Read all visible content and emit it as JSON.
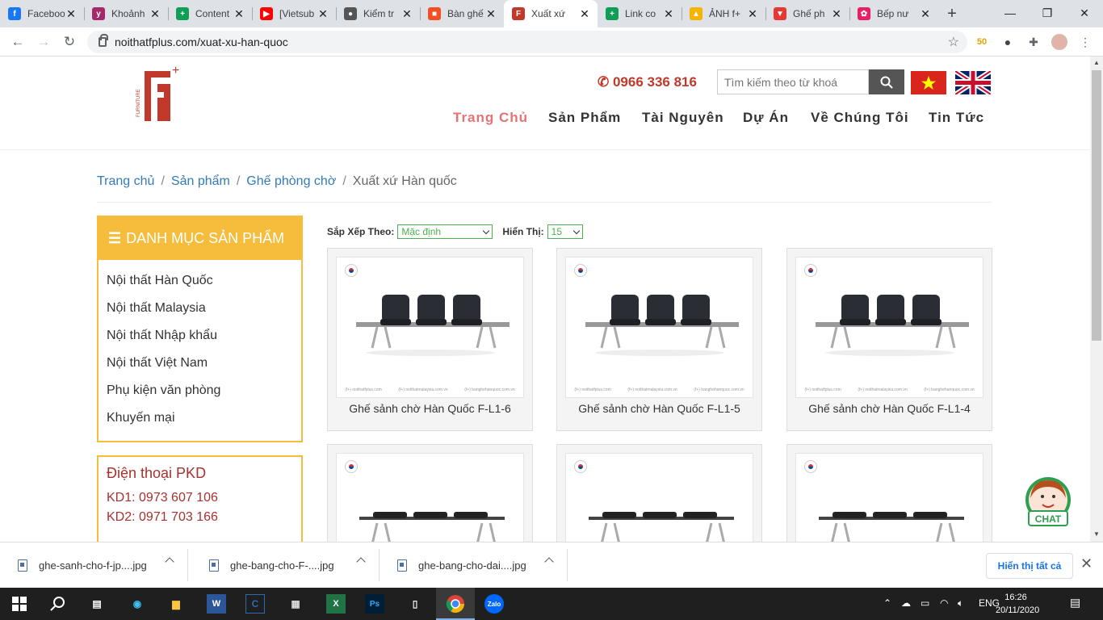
{
  "browser": {
    "tabs": [
      {
        "title": "Facebook",
        "icon": "facebook-icon",
        "color": "#1877f2",
        "glyph": "f"
      },
      {
        "title": "Khoảnh",
        "icon": "yoast-icon",
        "color": "#a4286a",
        "glyph": "y"
      },
      {
        "title": "Content",
        "icon": "sheets-icon",
        "color": "#0f9d58",
        "glyph": "+"
      },
      {
        "title": "[Vietsub",
        "icon": "youtube-icon",
        "color": "#ff0000",
        "glyph": "▶"
      },
      {
        "title": "Kiểm tr",
        "icon": "spy-icon",
        "color": "#555555",
        "glyph": "●"
      },
      {
        "title": "Bàn ghế",
        "icon": "microsoft-icon",
        "color": "#f25022",
        "glyph": "■"
      },
      {
        "title": "Xuất xứ",
        "icon": "noithat-icon",
        "color": "#c0392b",
        "glyph": "F",
        "active": true
      },
      {
        "title": "Link co",
        "icon": "sheets-icon",
        "color": "#0f9d58",
        "glyph": "+"
      },
      {
        "title": "ẢNH f+",
        "icon": "drive-icon",
        "color": "#f4b400",
        "glyph": "▲"
      },
      {
        "title": "Ghế ph",
        "icon": "arrow-icon",
        "color": "#e53935",
        "glyph": "▼"
      },
      {
        "title": "Bếp nư",
        "icon": "pink-icon",
        "color": "#e91e63",
        "glyph": "✿"
      }
    ],
    "url": "noithatfplus.com/xuat-xu-han-quoc"
  },
  "site": {
    "hotline": "0966 336 816",
    "search_placeholder": "Tìm kiếm theo từ khoá",
    "nav": [
      "Trang Chủ",
      "Sản Phẩm",
      "Tài Nguyên",
      "Dự Án",
      "Về Chúng Tôi",
      "Tin Tức"
    ],
    "breadcrumb": [
      "Trang chủ",
      "Sản phẩm",
      "Ghế phòng chờ",
      "Xuất xứ Hàn quốc"
    ],
    "sidebar": {
      "title": "DANH MỤC SẢN PHẨM",
      "items": [
        "Nội thất Hàn Quốc",
        "Nội thất Malaysia",
        "Nội thất Nhập khẩu",
        "Nội thất Việt Nam",
        "Phụ kiện văn phòng",
        "Khuyến mại"
      ]
    },
    "phone_box": {
      "title": "Điện thoại PKD",
      "lines": [
        "KD1: 0973 607 106",
        "KD2: 0971 703 166"
      ]
    },
    "sort": {
      "label": "Sắp Xếp Theo:",
      "value": "Mặc định",
      "show_label": "Hiển Thị:",
      "show_value": "15"
    },
    "products": [
      {
        "name": "Ghế sảnh chờ Hàn Quốc F-L1-6"
      },
      {
        "name": "Ghế sảnh chờ Hàn Quốc F-L1-5"
      },
      {
        "name": "Ghế sảnh chờ Hàn Quốc F-L1-4"
      },
      {
        "name": ""
      },
      {
        "name": ""
      },
      {
        "name": ""
      }
    ],
    "watermark": [
      "(f+) noithatfplus.com",
      "(f+) noithatmalaysia.com.vn",
      "(f+) banghehanquoc.com.vn"
    ],
    "chat_label": "CHAT"
  },
  "downloads": {
    "items": [
      "ghe-sanh-cho-f-jp....jpg",
      "ghe-bang-cho-F-....jpg",
      "ghe-bang-cho-dai....jpg"
    ],
    "show_all": "Hiển thị tất cả"
  },
  "taskbar": {
    "lang": "ENG",
    "time": "16:26",
    "date": "20/11/2020"
  }
}
